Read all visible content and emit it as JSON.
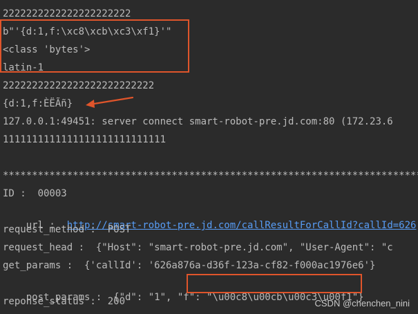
{
  "console": {
    "lines": [
      "2222222222222222222222",
      "b\"'{d:1,f:\\xc8\\xcb\\xc3\\xf1}'\"",
      "<class 'bytes'>",
      "latin-1",
      "22222222222222222222222222",
      "{d:1,f:ÈËÃñ}",
      "127.0.0.1:49451: server connect smart-robot-pre.jd.com:80 (172.23.6",
      "1111111111111111111111111111",
      "",
      "**************************************************************************",
      "ID :  00003",
      "url :  ",
      "request_method :  POST",
      "request_head :  {\"Host\": \"smart-robot-pre.jd.com\", \"User-Agent\": \"c",
      "get_params :  {'callId': '626a876a-d36f-123a-cf82-f000ac1976e6'}",
      "post_params :  {\"d\": \"1\", \"f\": ",
      "reponse_status :  200"
    ],
    "url_link": "http://smart-robot-pre.jd.com/callResultForCallId?callId=626",
    "post_params_value": "\"\\u00c8\\u00cb\\u00c3\\u00f1\"}"
  },
  "watermark": "CSDN @chenchen_nini",
  "colors": {
    "background": "#2b2b2b",
    "text": "#bbbbbb",
    "link": "#589df6",
    "highlight": "#e0552b"
  }
}
